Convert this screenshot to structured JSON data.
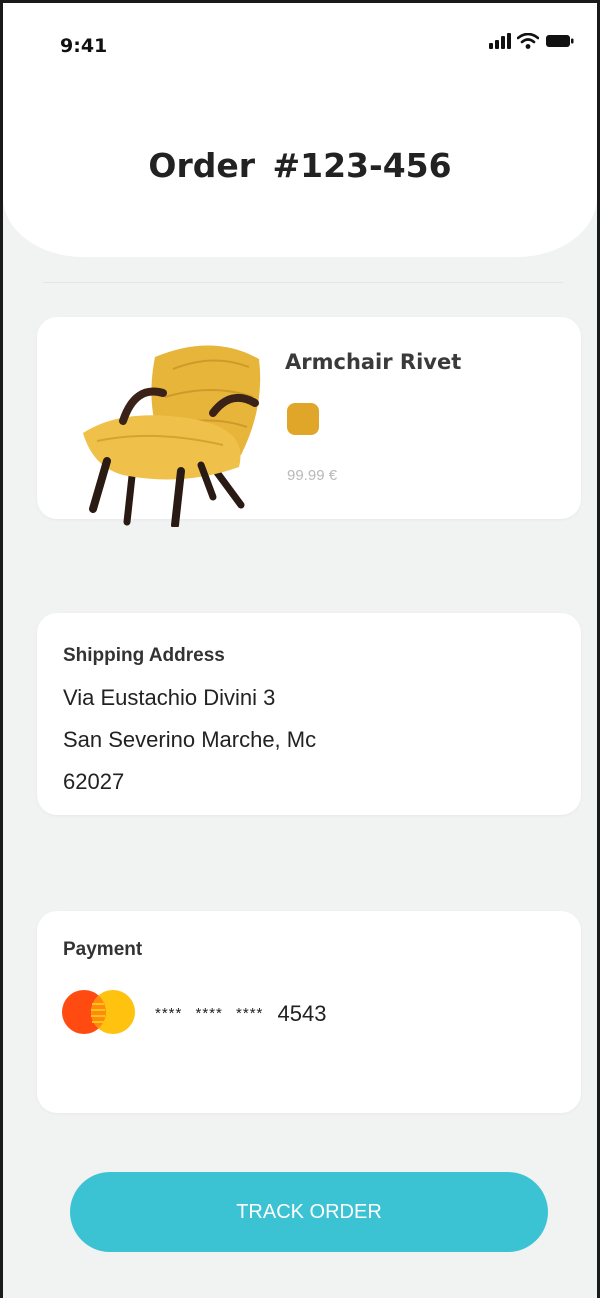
{
  "status_bar": {
    "time": "9:41",
    "icons": [
      "signal-icon",
      "wifi-icon",
      "battery-icon"
    ]
  },
  "header": {
    "title": "Order  #123-456"
  },
  "product": {
    "name": "Armchair Rivet",
    "image": "armchair-image",
    "color_swatch": "#e0a62a",
    "price": "99.99 €"
  },
  "shipping": {
    "heading": "Shipping Address",
    "lines": [
      "Via Eustachio Divini 3",
      "San Severino Marche, Mc",
      "62027"
    ]
  },
  "payment": {
    "heading": "Payment",
    "card_logo": "mastercard-icon",
    "masked": "****  ****  ****",
    "last4": "4543"
  },
  "actions": {
    "track_label": "TRACK ORDER"
  },
  "colors": {
    "background": "#f1f2f2",
    "card": "#ffffff",
    "accent": "#3cc3d3",
    "swatch": "#e0a62a",
    "mastercard_red": "#ff4a12",
    "mastercard_yellow": "#ffc20e"
  }
}
